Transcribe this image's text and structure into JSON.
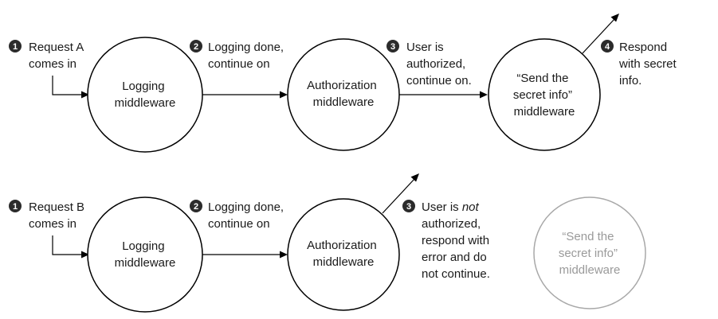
{
  "colors": {
    "ink": "#000000",
    "disabled_text": "#9a9a9a",
    "disabled_stroke": "#a8a8a8",
    "badge_fill": "#2b2b2b"
  },
  "flow_a": {
    "step1": {
      "number": "1",
      "lines": [
        "Request A",
        "comes in"
      ]
    },
    "logging": {
      "lines": [
        "Logging",
        "middleware"
      ]
    },
    "step2": {
      "number": "2",
      "lines": [
        "Logging done,",
        "continue on"
      ]
    },
    "authorization": {
      "lines": [
        "Authorization",
        "middleware"
      ]
    },
    "step3": {
      "number": "3",
      "lines": [
        "User is",
        "authorized,",
        "continue on."
      ]
    },
    "secret": {
      "lines": [
        "“Send the",
        "secret info”",
        "middleware"
      ]
    },
    "step4": {
      "number": "4",
      "lines": [
        "Respond",
        "with secret",
        "info."
      ]
    }
  },
  "flow_b": {
    "step1": {
      "number": "1",
      "lines": [
        "Request B",
        "comes in"
      ]
    },
    "logging": {
      "lines": [
        "Logging",
        "middleware"
      ]
    },
    "step2": {
      "number": "2",
      "lines": [
        "Logging done,",
        "continue on"
      ]
    },
    "authorization": {
      "lines": [
        "Authorization",
        "middleware"
      ]
    },
    "step3": {
      "number": "3",
      "line1_prefix": "User is ",
      "line1_emphasis": "not",
      "lines": [
        "authorized,",
        "respond with",
        "error and do",
        "not continue."
      ]
    },
    "secret": {
      "lines": [
        "“Send the",
        "secret info”",
        "middleware"
      ],
      "state": "not reached"
    }
  }
}
